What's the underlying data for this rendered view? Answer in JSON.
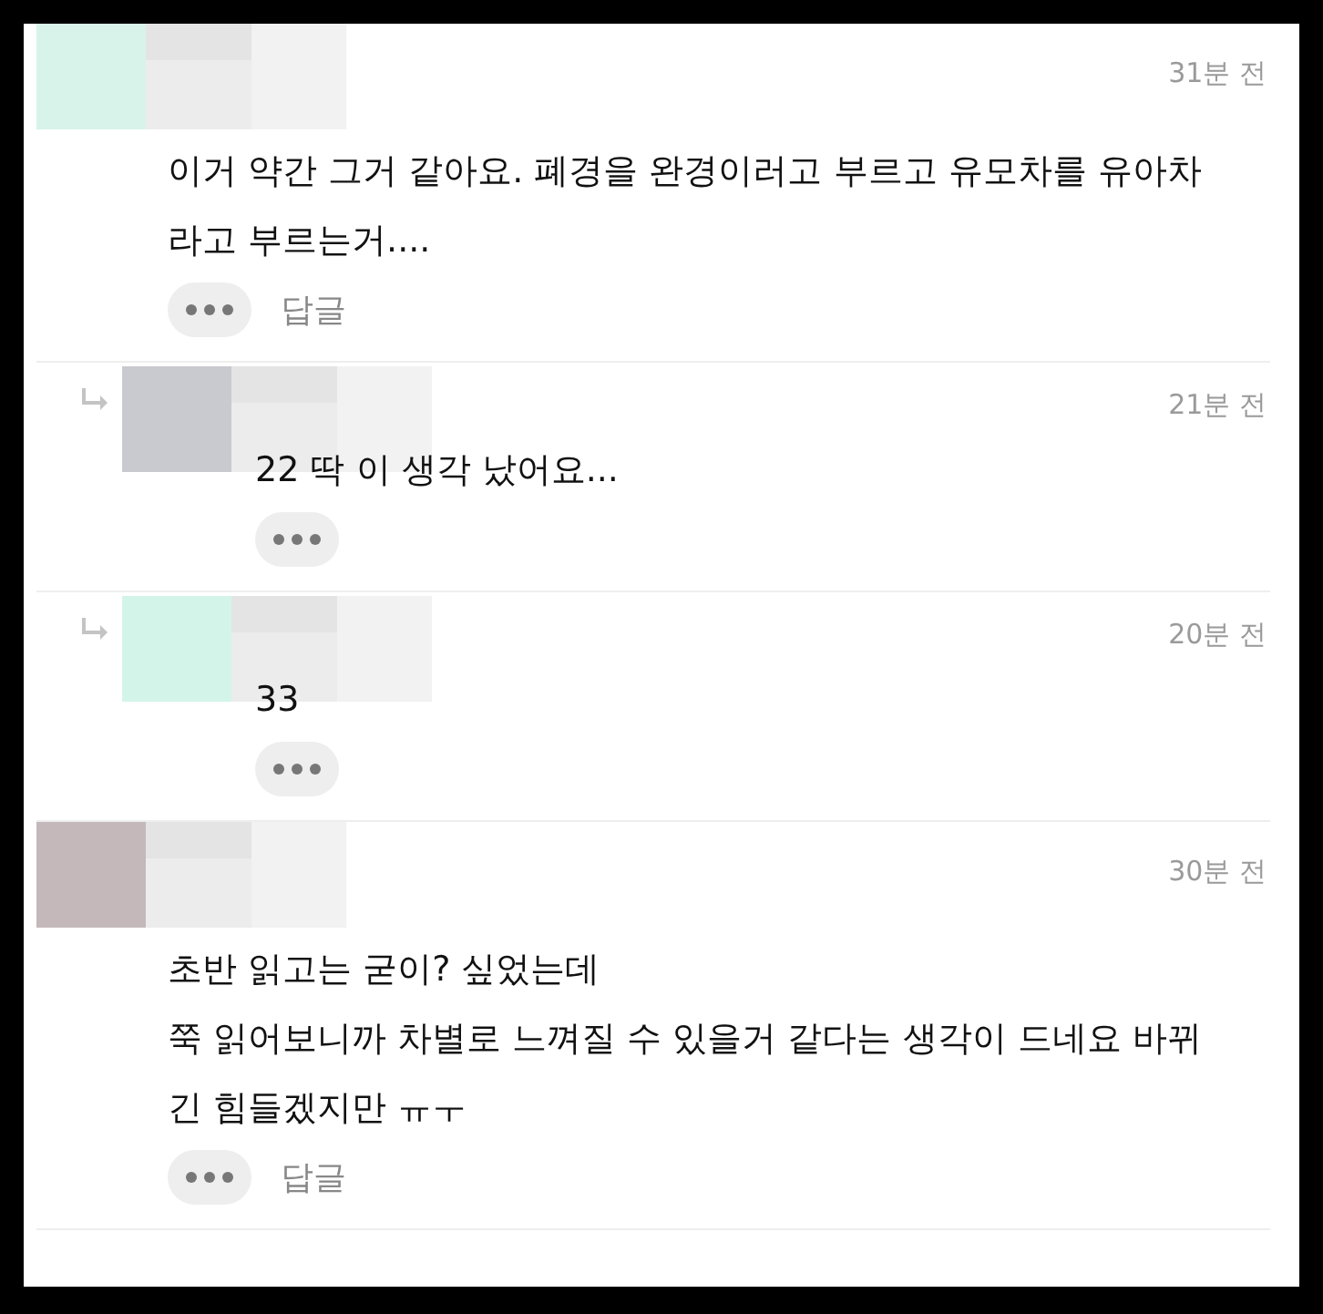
{
  "comments": [
    {
      "kind": "comment",
      "color": "#d8f3ea",
      "time": "31분 전",
      "lines": [
        "이거 약간 그거 같아요. 폐경을 완경이러고 부르고 유모차를 유아차",
        "라고 부르는거...."
      ],
      "reply_link": "답글"
    },
    {
      "kind": "reply",
      "color": "#c9c9d0",
      "time": "21분 전",
      "lines": [
        "22 딱 이 생각 났어요..."
      ]
    },
    {
      "kind": "reply",
      "color": "#d3f5e9",
      "time": "20분 전",
      "lines": [
        "33"
      ]
    },
    {
      "kind": "comment",
      "color": "#c4b8bb",
      "time": "30분 전",
      "lines": [
        "초반 읽고는 굳이? 싶었는데",
        "쭉 읽어보니까 차별로 느껴질 수 있을거 같다는 생각이 드네요 바뀌",
        "긴 힘들겠지만 ㅠㅜ"
      ],
      "reply_link": "답글"
    }
  ]
}
